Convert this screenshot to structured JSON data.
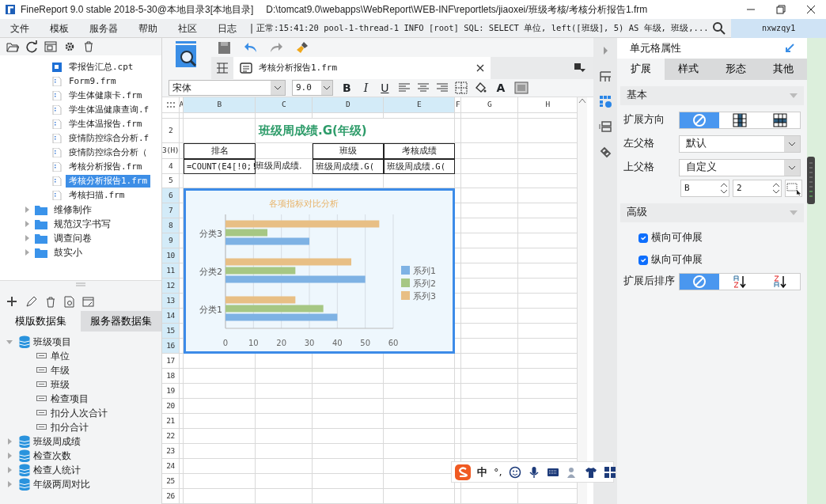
{
  "window": {
    "title": "FineReport 9.0 stable 2018-5-30@本地目录3[本地目录]",
    "path": "D:\\tomcat9.0\\webapps\\WebReport\\WEB-INF\\reportlets/jiaoxei/班级考核/考核分析报告1.frm"
  },
  "menu": [
    "文件",
    "模板",
    "服务器",
    "帮助",
    "社区",
    "日志"
  ],
  "log_divider": "|",
  "log": "正常:15:41:20 pool-1-thread-1 INFO [root] SQL: SELECT 单位, left([班级], 5) AS 年级, 班级,...",
  "user": "nxwzqy1",
  "file_tree": [
    {
      "kind": "cpt",
      "name": "零报告汇总.cpt",
      "selected": false
    },
    {
      "kind": "frm",
      "name": "Form9.frm",
      "selected": false
    },
    {
      "kind": "frm",
      "name": "学生体健康卡.frm",
      "selected": false
    },
    {
      "kind": "frm",
      "name": "学生体温健康查询.f",
      "selected": false
    },
    {
      "kind": "frm",
      "name": "学生体温报告.frm",
      "selected": false
    },
    {
      "kind": "frm",
      "name": "疫情防控综合分析.f",
      "selected": false
    },
    {
      "kind": "frm",
      "name": "疫情防控综合分析（",
      "selected": false
    },
    {
      "kind": "frm",
      "name": "考核分析报告.frm",
      "selected": false
    },
    {
      "kind": "frm",
      "name": "考核分析报告1.frm",
      "selected": true
    },
    {
      "kind": "frm",
      "name": "考核扫描.frm",
      "selected": false
    },
    {
      "kind": "folder",
      "name": "维修制作",
      "selected": false,
      "expanded": false
    },
    {
      "kind": "folder",
      "name": "规范汉字书写",
      "selected": false,
      "expanded": false
    },
    {
      "kind": "folder",
      "name": "调查问卷",
      "selected": false,
      "expanded": false
    },
    {
      "kind": "folder",
      "name": "鼓实小",
      "selected": false,
      "expanded": false
    }
  ],
  "dataset_tabs": [
    {
      "label": "模版数据集",
      "selected": true
    },
    {
      "label": "服务器数据集",
      "selected": false
    }
  ],
  "datasets": [
    {
      "name": "班级项目",
      "expanded": true,
      "children": [
        {
          "name": "单位"
        },
        {
          "name": "年级"
        },
        {
          "name": "班级"
        },
        {
          "name": "检查项目"
        },
        {
          "name": "扣分人次合计"
        },
        {
          "name": "扣分合计"
        }
      ]
    },
    {
      "name": "班级周成绩",
      "expanded": false
    },
    {
      "name": "检查次数",
      "expanded": false
    },
    {
      "name": "检查人统计",
      "expanded": false
    },
    {
      "name": "年级两周对比",
      "expanded": false
    }
  ],
  "editor_tab": {
    "label": "考核分析报告1.frm"
  },
  "format": {
    "font": "宋体",
    "size": "9.0",
    "bold": "B",
    "italic": "I",
    "underline": "U",
    "font_color": "A"
  },
  "sheet": {
    "columns": [
      {
        "label": "A",
        "selected": false
      },
      {
        "label": "B",
        "selected": true
      },
      {
        "label": "C",
        "selected": true
      },
      {
        "label": "D",
        "selected": true
      },
      {
        "label": "E",
        "selected": true
      },
      {
        "label": "F",
        "selected": false
      },
      {
        "label": "G",
        "selected": false
      },
      {
        "label": "H",
        "selected": false
      }
    ],
    "rows": [
      {
        "selected": false,
        "cells": []
      },
      {
        "header": "2",
        "selected": false,
        "cells": [
          {
            "kind": "plain"
          },
          {
            "kind": "plain"
          },
          {
            "kind": "title",
            "text": "班级周成绩.G(年级)"
          }
        ]
      },
      {
        "header": "3(H)",
        "selected": false,
        "cells": [
          {
            "kind": "plain"
          },
          {
            "kind": "head",
            "text": "排名"
          },
          {
            "kind": "plain"
          },
          {
            "kind": "head",
            "text": "班级"
          },
          {
            "kind": "head",
            "text": "考核成绩"
          }
        ]
      },
      {
        "header": "4",
        "selected": false,
        "cells": [
          {
            "kind": "plain"
          },
          {
            "kind": "data",
            "text": "=COUNT(E4[!0;!"
          },
          {
            "kind": "plain",
            "text": "班级周成绩."
          },
          {
            "kind": "data",
            "text": "班级周成绩.G("
          },
          {
            "kind": "data",
            "text": "班级周成绩.G("
          }
        ]
      },
      {
        "header": "5",
        "selected": false,
        "cells": []
      },
      {
        "header": "6",
        "selected": true,
        "cells": []
      },
      {
        "header": "7",
        "selected": true,
        "cells": []
      },
      {
        "header": "8",
        "selected": true,
        "cells": []
      },
      {
        "header": "9",
        "selected": true,
        "cells": []
      },
      {
        "header": "10",
        "selected": true,
        "cells": []
      },
      {
        "header": "11",
        "selected": true,
        "cells": []
      },
      {
        "header": "12",
        "selected": true,
        "cells": []
      },
      {
        "header": "13",
        "selected": true,
        "cells": []
      },
      {
        "header": "14",
        "selected": true,
        "cells": []
      },
      {
        "header": "15",
        "selected": true,
        "cells": []
      },
      {
        "header": "16",
        "selected": true,
        "cells": []
      },
      {
        "header": "17",
        "selected": false,
        "cells": []
      },
      {
        "header": "18",
        "selected": false,
        "cells": []
      },
      {
        "header": "19",
        "selected": false,
        "cells": []
      },
      {
        "header": "20",
        "selected": false,
        "cells": []
      },
      {
        "header": "21",
        "selected": false,
        "cells": []
      },
      {
        "header": "22",
        "selected": false,
        "cells": []
      },
      {
        "header": "23",
        "selected": false,
        "cells": []
      },
      {
        "header": "24",
        "selected": false,
        "cells": []
      },
      {
        "header": "25",
        "selected": false,
        "cells": []
      },
      {
        "header": "26",
        "selected": false,
        "cells": []
      }
    ],
    "chart_data": {
      "type": "bar",
      "orientation": "horizontal",
      "title": "各项指标对比分析",
      "categories": [
        "分类3",
        "分类2",
        "分类1"
      ],
      "xlim": [
        0,
        60
      ],
      "xticks": [
        {
          "value": 0,
          "label": "0"
        },
        {
          "value": 10,
          "label": "10"
        },
        {
          "value": 20,
          "label": "20"
        },
        {
          "value": 30,
          "label": "30"
        },
        {
          "value": 40,
          "label": "40"
        },
        {
          "value": 50,
          "label": "50"
        },
        {
          "value": 60,
          "label": "60"
        }
      ],
      "grid": true,
      "legend": "right",
      "series": [
        {
          "name": "系列1",
          "color": "#7eb2e4",
          "values": [
            30,
            50,
            40
          ]
        },
        {
          "name": "系列2",
          "color": "#a6c784",
          "values": [
            15,
            25,
            35
          ]
        },
        {
          "name": "系列3",
          "color": "#e8bf85",
          "values": [
            55,
            45,
            25
          ]
        }
      ]
    }
  },
  "cell_panel": {
    "title": "单元格属性",
    "tabs": [
      {
        "label": "扩展",
        "selected": true
      },
      {
        "label": "样式",
        "selected": false
      },
      {
        "label": "形态",
        "selected": false
      },
      {
        "label": "其他",
        "selected": false
      }
    ],
    "basic": "基本",
    "expand_direction": {
      "label": "扩展方向",
      "options": [
        {
          "kind": "none",
          "selected": true
        },
        {
          "kind": "vertical",
          "selected": false
        },
        {
          "kind": "horizontal",
          "selected": false
        }
      ]
    },
    "left_parent": {
      "label": "左父格",
      "value": "默认"
    },
    "top_parent": {
      "label": "上父格",
      "value": "自定义",
      "column": "B",
      "row": "2"
    },
    "advanced": "高级",
    "checks": [
      {
        "label": "横向可伸展",
        "checked": true
      },
      {
        "label": "纵向可伸展",
        "checked": true
      }
    ],
    "sort": {
      "label": "扩展后排序",
      "options": [
        {
          "kind": "none",
          "selected": true
        },
        {
          "kind": "asc",
          "selected": false
        },
        {
          "kind": "desc",
          "selected": false
        }
      ]
    }
  },
  "ime": {
    "mode": "中",
    "punct": "°,"
  }
}
